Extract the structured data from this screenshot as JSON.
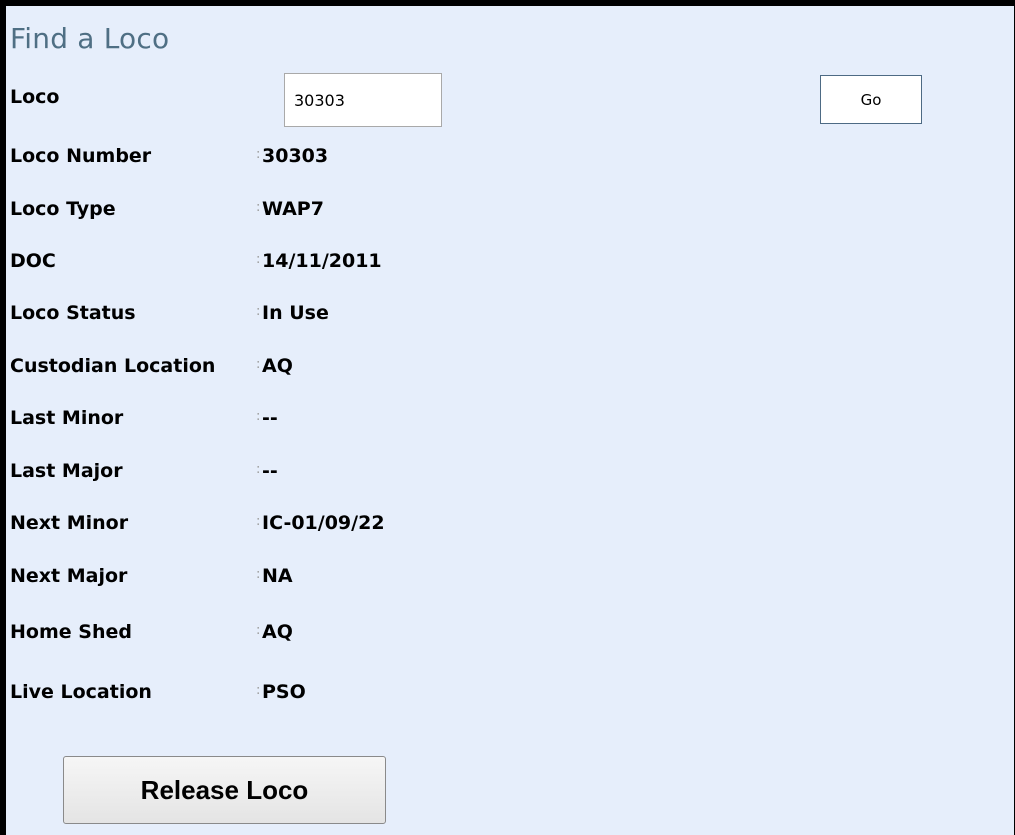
{
  "header": {
    "title": "Find a Loco"
  },
  "search": {
    "label": "Loco",
    "value": "30303",
    "go_label": "Go"
  },
  "details": [
    {
      "label": "Loco Number",
      "value": "30303"
    },
    {
      "label": "Loco Type",
      "value": "WAP7"
    },
    {
      "label": "DOC",
      "value": "14/11/2011"
    },
    {
      "label": "Loco Status",
      "value": "In Use"
    },
    {
      "label": "Custodian Location",
      "value": "AQ"
    },
    {
      "label": "Last Minor",
      "value": "--"
    },
    {
      "label": "Last Major",
      "value": "--"
    },
    {
      "label": "Next Minor",
      "value": "IC-01/09/22"
    },
    {
      "label": "Next Major",
      "value": "NA"
    },
    {
      "label": "Home Shed",
      "value": "AQ"
    },
    {
      "label": "Live Location",
      "value": "PSO"
    }
  ],
  "separator": ":",
  "actions": {
    "release_label": "Release Loco"
  },
  "colors": {
    "panel_background": "#e6eefb",
    "title_color": "#4f6f84"
  }
}
